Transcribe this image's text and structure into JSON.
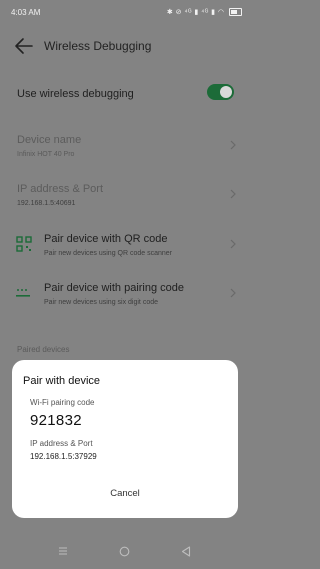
{
  "status_bar": {
    "time": "4:03 AM",
    "icons": "✱ ⊘ ⁴ᴳ ▮ ⁴ᴳ ▮ ◠"
  },
  "app_bar": {
    "title": "Wireless Debugging",
    "back_icon": "arrow-left-icon"
  },
  "settings": {
    "use_wireless": {
      "label": "Use wireless debugging",
      "enabled": true,
      "accent": "#1c6b38"
    },
    "device_name": {
      "label": "Device name",
      "value": "Infinix HOT 40 Pro"
    },
    "ip_address": {
      "label": "IP address & Port",
      "value": "192.168.1.5:40691"
    },
    "pair_qr": {
      "label": "Pair device with QR code",
      "sub": "Pair new devices using QR code scanner",
      "icon": "qr-code-icon"
    },
    "pair_code": {
      "label": "Pair device with pairing code",
      "sub": "Pair new devices using six digit code",
      "icon": "pairing-code-icon"
    },
    "paired_header": "Paired devices"
  },
  "dialog": {
    "title": "Pair with device",
    "code_label": "Wi-Fi pairing code",
    "code": "921832",
    "address_label": "IP address & Port",
    "address": "192.168.1.5:37929",
    "cancel": "Cancel"
  },
  "nav_bar": {
    "icons": [
      "menu-icon",
      "home-icon",
      "back-icon"
    ]
  }
}
